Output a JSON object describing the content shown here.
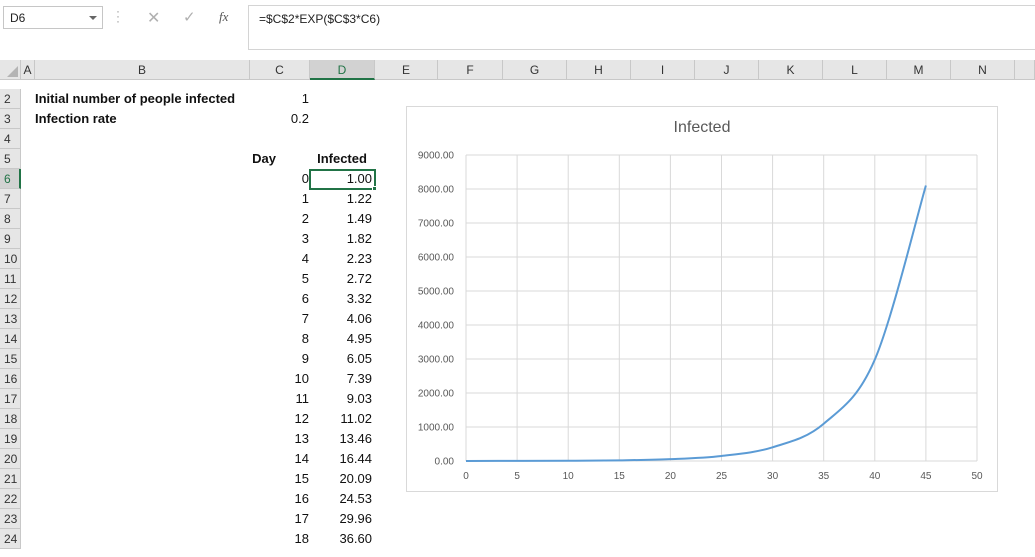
{
  "formula_bar": {
    "name_box": "D6",
    "formula": "=$C$2*EXP($C$3*C6)"
  },
  "columns": [
    "A",
    "B",
    "C",
    "D",
    "E",
    "F",
    "G",
    "H",
    "I",
    "J",
    "K",
    "L",
    "M",
    "N"
  ],
  "rows": [
    "2",
    "3",
    "4",
    "5",
    "6",
    "7",
    "8",
    "9",
    "10",
    "11",
    "12",
    "13",
    "14",
    "15",
    "16",
    "17",
    "18",
    "19",
    "20",
    "21",
    "22",
    "23",
    "24"
  ],
  "sheet": {
    "label_initial": "Initial number of people infected",
    "value_initial": "1",
    "label_rate": "Infection rate",
    "value_rate": "0.2",
    "header_day": "Day",
    "header_infected": "Infected",
    "days": [
      "0",
      "1",
      "2",
      "3",
      "4",
      "5",
      "6",
      "7",
      "8",
      "9",
      "10",
      "11",
      "12",
      "13",
      "14",
      "15",
      "16",
      "17",
      "18"
    ],
    "infected": [
      "1.00",
      "1.22",
      "1.49",
      "1.82",
      "2.23",
      "2.72",
      "3.32",
      "4.06",
      "4.95",
      "6.05",
      "7.39",
      "9.03",
      "11.02",
      "13.46",
      "16.44",
      "20.09",
      "24.53",
      "29.96",
      "36.60"
    ]
  },
  "chart_data": {
    "type": "line",
    "title": "Infected",
    "xlabel": "",
    "ylabel": "",
    "xlim": [
      0,
      50
    ],
    "ylim": [
      0,
      9000
    ],
    "x_ticks": [
      "0",
      "5",
      "10",
      "15",
      "20",
      "25",
      "30",
      "35",
      "40",
      "45",
      "50"
    ],
    "y_ticks": [
      "0.00",
      "1000.00",
      "2000.00",
      "3000.00",
      "4000.00",
      "5000.00",
      "6000.00",
      "7000.00",
      "8000.00",
      "9000.00"
    ],
    "grid": true,
    "legend": "none",
    "series": [
      {
        "color": "#5b9bd5",
        "x": [
          0,
          5,
          10,
          15,
          20,
          25,
          30,
          35,
          40,
          45
        ],
        "y": [
          1.0,
          2.72,
          7.39,
          20.09,
          54.6,
          148.41,
          403.43,
          1096.63,
          2980.96,
          8103.08
        ]
      }
    ]
  }
}
